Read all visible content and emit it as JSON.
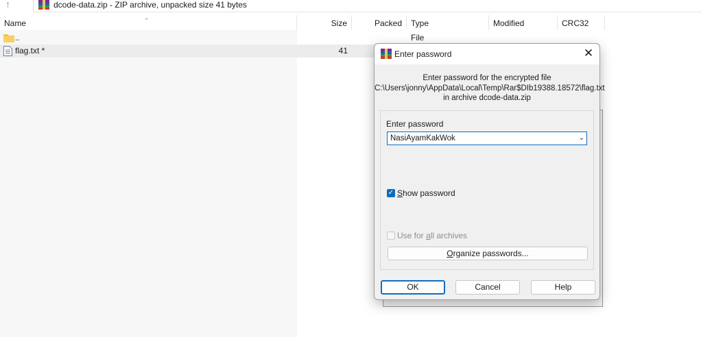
{
  "address": {
    "text": "dcode-data.zip - ZIP archive, unpacked size 41 bytes"
  },
  "columns": {
    "name": "Name",
    "size": "Size",
    "packed": "Packed",
    "type": "Type",
    "modified": "Modified",
    "crc": "CRC32"
  },
  "rows": [
    {
      "name": "..",
      "size": "",
      "type": "File folder"
    },
    {
      "name": "flag.txt *",
      "size": "41",
      "type": ""
    }
  ],
  "dialog": {
    "title": "Enter password",
    "info_line1": "Enter password for the encrypted file",
    "info_line2": "C:\\Users\\jonny\\AppData\\Local\\Temp\\Rar$DIb19388.18572\\flag.txt",
    "info_line3": "in archive dcode-data.zip",
    "password_label": "Enter password",
    "password_value": "NasiAyamKakWok",
    "show_password_prefix": "",
    "show_password_ul": "S",
    "show_password_rest": "how password",
    "show_password_checked": true,
    "use_all_prefix": "Use for ",
    "use_all_ul": "a",
    "use_all_rest": "ll archives",
    "use_all_checked": false,
    "organize_ul": "O",
    "organize_rest": "rganize passwords...",
    "ok_label": "OK",
    "cancel_label": "Cancel",
    "help_label": "Help"
  },
  "colors": {
    "accent": "#0f6cbd",
    "selection": "#ececec"
  }
}
